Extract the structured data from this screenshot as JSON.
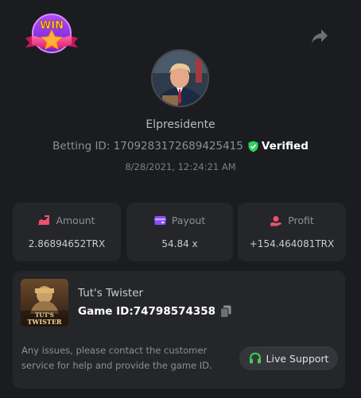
{
  "badge": {
    "text": "WIN"
  },
  "user": {
    "name": "Elpresidente",
    "betting_id_label": "Betting ID:",
    "betting_id": "1709283172689425415",
    "verified_label": "Verified",
    "timestamp": "8/28/2021, 12:24:21 AM"
  },
  "stats": [
    {
      "label": "Amount",
      "value": "2.86894652TRX",
      "icon": "amount-icon",
      "color": "#f0506e"
    },
    {
      "label": "Payout",
      "value": "54.84 x",
      "icon": "wallet-icon",
      "color": "#8b4dff"
    },
    {
      "label": "Profit",
      "value": "+154.464081TRX",
      "icon": "profit-icon",
      "color": "#f0506e"
    }
  ],
  "game": {
    "name": "Tut's Twister",
    "id_label": "Game ID:",
    "id": "74798574358",
    "thumb_text": "TUT'S\nTWISTER"
  },
  "support": {
    "message": "Any issues, please contact the customer service for help and provide the game ID.",
    "button_label": "Live Support",
    "icon_color": "#3fcf5a"
  },
  "colors": {
    "background": "#1b1c1f",
    "card": "#25262a",
    "verified_green": "#2ed15a"
  }
}
